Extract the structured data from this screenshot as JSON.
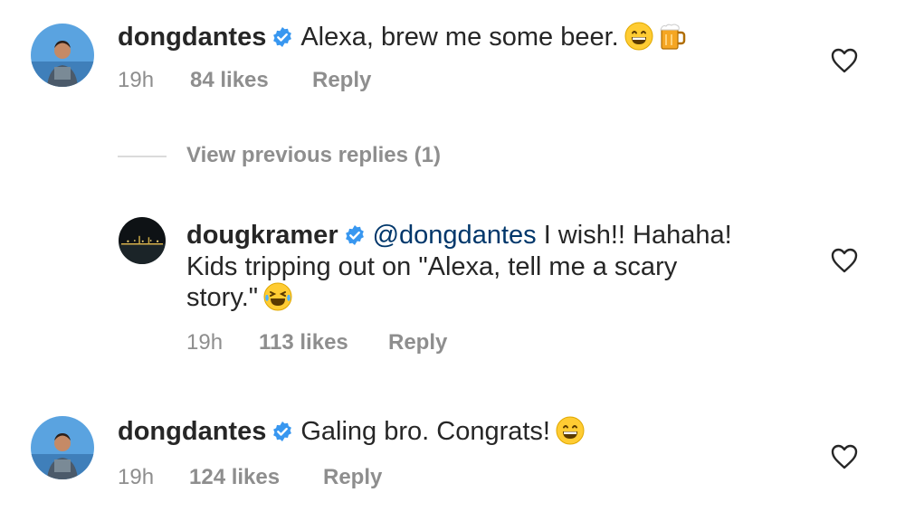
{
  "comments": [
    {
      "username": "dongdantes",
      "text": "Alexa, brew me some beer.",
      "time": "19h",
      "likes": "84 likes",
      "reply_label": "Reply"
    },
    {
      "username": "dougkramer",
      "mention": "@dongdantes",
      "text_line1": " I wish!! Hahaha!",
      "text_line2": "Kids tripping out on \"Alexa, tell me a scary",
      "text_line3": "story.\"",
      "time": "19h",
      "likes": "113 likes",
      "reply_label": "Reply"
    },
    {
      "username": "dongdantes",
      "text": "Galing bro. Congrats!",
      "time": "19h",
      "likes": "124 likes",
      "reply_label": "Reply"
    }
  ],
  "view_replies": "View previous replies (1)",
  "icons": {
    "verified": "verified-badge-icon",
    "like": "heart-outline-icon",
    "emoji_grin": "grinning-face-emoji",
    "emoji_beer": "beer-mug-emoji",
    "emoji_laugh": "tears-of-joy-emoji"
  },
  "colors": {
    "text": "#262626",
    "muted": "#8e8e8e",
    "verified_blue": "#3897f0",
    "mention": "#00376b"
  }
}
